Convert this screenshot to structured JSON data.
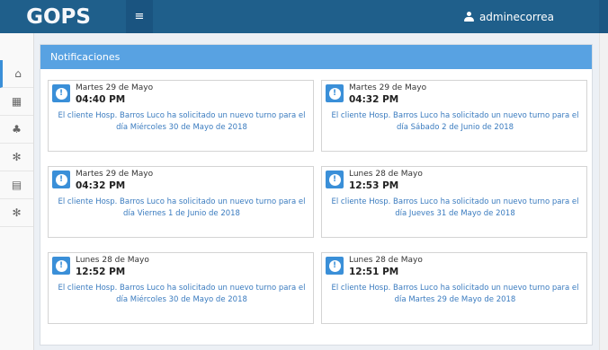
{
  "app": {
    "logo": "GOPS",
    "menu_icon": "≡",
    "username": "adminecorrea"
  },
  "sidebar": {
    "items": [
      {
        "icon": "home-icon",
        "glyph": "⌂"
      },
      {
        "icon": "calendar-icon",
        "glyph": "▦"
      },
      {
        "icon": "users-icon",
        "glyph": "♣"
      },
      {
        "icon": "gear-icon",
        "glyph": "✻"
      },
      {
        "icon": "list-icon",
        "glyph": "▤"
      },
      {
        "icon": "settings-icon",
        "glyph": "✻"
      }
    ]
  },
  "panel": {
    "title": "Notificaciones"
  },
  "notifications": [
    {
      "date": "Martes 29 de Mayo",
      "time": "04:40 PM",
      "message": "El cliente Hosp. Barros Luco ha solicitado un nuevo turno para el día Miércoles 30 de Mayo de 2018"
    },
    {
      "date": "Martes 29 de Mayo",
      "time": "04:32 PM",
      "message": "El cliente Hosp. Barros Luco ha solicitado un nuevo turno para el día Sábado 2 de Junio de 2018"
    },
    {
      "date": "Martes 29 de Mayo",
      "time": "04:32 PM",
      "message": "El cliente Hosp. Barros Luco ha solicitado un nuevo turno para el día Viernes 1 de Junio de 2018"
    },
    {
      "date": "Lunes 28 de Mayo",
      "time": "12:53 PM",
      "message": "El cliente Hosp. Barros Luco ha solicitado un nuevo turno para el día Jueves 31 de Mayo de 2018"
    },
    {
      "date": "Lunes 28 de Mayo",
      "time": "12:52 PM",
      "message": "El cliente Hosp. Barros Luco ha solicitado un nuevo turno para el día Miércoles 30 de Mayo de 2018"
    },
    {
      "date": "Lunes 28 de Mayo",
      "time": "12:51 PM",
      "message": "El cliente Hosp. Barros Luco ha solicitado un nuevo turno para el día Martes 29 de Mayo de 2018"
    }
  ],
  "badge_glyph": "!",
  "colors": {
    "header": "#1f5f8b",
    "panel_header": "#58a2e2",
    "accent": "#3a8fd8",
    "message_text": "#3a7bbf"
  }
}
